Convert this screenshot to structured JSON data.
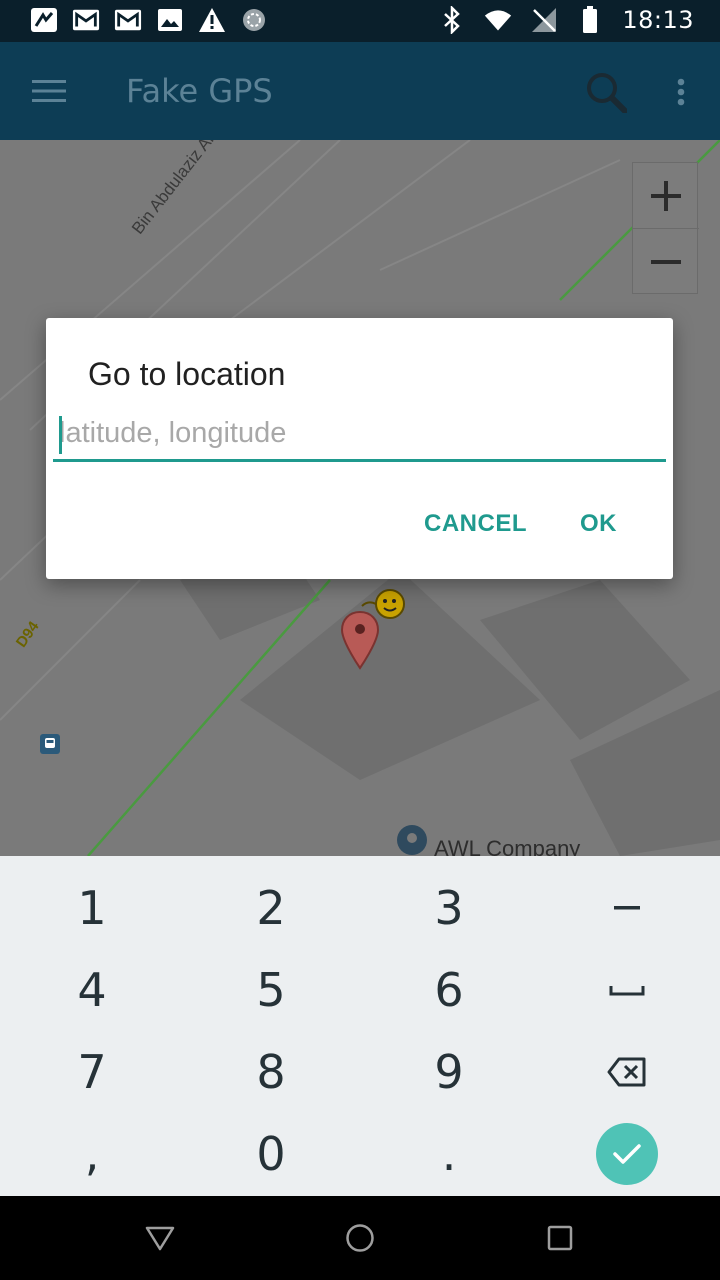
{
  "status_bar": {
    "time": "18:13",
    "left_icons": [
      "app-notification-icon",
      "gmail-icon",
      "gmail-icon",
      "image-icon",
      "warning-icon",
      "sync-icon"
    ],
    "right_icons": [
      "bluetooth-icon",
      "wifi-icon",
      "no-signal-icon",
      "battery-icon"
    ]
  },
  "app_bar": {
    "title": "Fake GPS",
    "color": "#0d3d55"
  },
  "map": {
    "street_label": "Bin Abdulaziz Al Saud St",
    "road_label": "D94",
    "poi_label": "AWL Company",
    "zoom_in": "+",
    "zoom_out": "−"
  },
  "dialog": {
    "title": "Go to location",
    "input_placeholder": "latitude, longitude",
    "input_value": "",
    "cancel_label": "CANCEL",
    "ok_label": "OK",
    "accent": "#1f9a8e"
  },
  "keyboard": {
    "rows": [
      [
        "1",
        "2",
        "3",
        "–"
      ],
      [
        "4",
        "5",
        "6",
        "␣"
      ],
      [
        "7",
        "8",
        "9",
        "⌫"
      ],
      [
        ",",
        "0",
        ".",
        "✓"
      ]
    ]
  }
}
